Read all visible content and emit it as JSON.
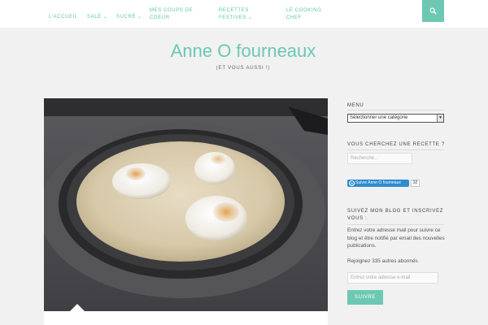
{
  "nav": {
    "items": [
      {
        "label": "L'accueil",
        "has_caret": false
      },
      {
        "label": "Salé",
        "has_caret": true
      },
      {
        "label": "Sucré",
        "has_caret": true
      },
      {
        "label": "Mes coups de",
        "label2": "coeur"
      },
      {
        "label": "Recettes",
        "label2": "festives",
        "has_caret": true
      },
      {
        "label": "Le cooking",
        "label2": "chef"
      }
    ],
    "caret": "⌄",
    "search_icon": "search-icon"
  },
  "header": {
    "title": "Anne O fourneaux",
    "tagline": "(et vous aussi !)"
  },
  "sidebar": {
    "menu_title": "Menu",
    "category_select": "Sélectionner une catégorie",
    "search_title": "Vous cherchez une recette ?",
    "search_placeholder": "Recherche…",
    "follow_label": "Suivre Anne O fourneaux",
    "follow_count": "32",
    "subscribe_title_1": "Suivez mon blog et inscrivez",
    "subscribe_title_2": "vous :",
    "subscribe_text": "Entrez votre adresse mail pour suivre ce blog et être notifié par email des nouvelles publications.",
    "subscribers_text": "Rejoignez 335 autres abonnés",
    "email_placeholder": "Entrez votre adresse e-mail",
    "subscribe_button": "Suivre"
  },
  "colors": {
    "accent": "#6cc8b2",
    "follow_blue": "#2f8ccf"
  }
}
